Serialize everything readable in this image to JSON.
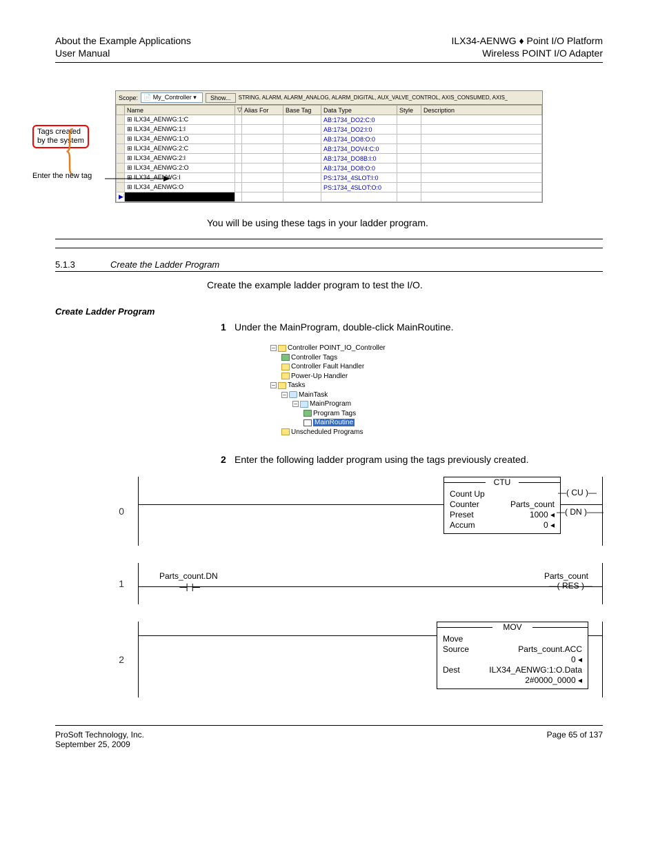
{
  "header": {
    "left1": "About the Example Applications",
    "left2": "User Manual",
    "right1": "ILX34-AENWG ♦ Point I/O Platform",
    "right2": "Wireless POINT I/O Adapter"
  },
  "fig1": {
    "callout_created1": "Tags created",
    "callout_created2": "by the system",
    "callout_enter": "Enter the new tag",
    "toolbar": {
      "scope_label": "Scope:",
      "scope_value": "My_Controller",
      "show_btn": "Show...",
      "filter": "STRING, ALARM, ALARM_ANALOG, ALARM_DIGITAL, AUX_VALVE_CONTROL, AXIS_CONSUMED, AXIS_"
    },
    "columns": {
      "name": "Name",
      "alias": "Alias For",
      "base": "Base Tag",
      "type": "Data Type",
      "style": "Style",
      "desc": "Description"
    },
    "rows": [
      {
        "name": "ILX34_AENWG:1:C",
        "type": "AB:1734_DO2:C:0"
      },
      {
        "name": "ILX34_AENWG:1:I",
        "type": "AB:1734_DO2:I:0"
      },
      {
        "name": "ILX34_AENWG:1:O",
        "type": "AB:1734_DO8:O:0"
      },
      {
        "name": "ILX34_AENWG:2:C",
        "type": "AB:1734_DOV4:C:0"
      },
      {
        "name": "ILX34_AENWG:2:I",
        "type": "AB:1734_DO8B:I:0"
      },
      {
        "name": "ILX34_AENWG:2:O",
        "type": "AB:1734_DO8:O:0"
      },
      {
        "name": "ILX34_AENWG:I",
        "type": "PS:1734_4SLOT:I:0"
      },
      {
        "name": "ILX34_AENWG:O",
        "type": "PS:1734_4SLOT:O:0"
      }
    ]
  },
  "body1": "You will be using these tags in your ladder program.",
  "section": {
    "num": "5.1.3",
    "title": "Create the Ladder Program"
  },
  "body2": "Create the example ladder program to test the I/O.",
  "heading_create": "Create Ladder Program",
  "steps": {
    "s1n": "1",
    "s1t": "Under the MainProgram, double-click MainRoutine.",
    "s2n": "2",
    "s2t": "Enter the following ladder program using the tags previously created."
  },
  "tree": {
    "controller": "Controller POINT_IO_Controller",
    "controller_tags": "Controller Tags",
    "fault_handler": "Controller Fault Handler",
    "powerup": "Power-Up Handler",
    "tasks": "Tasks",
    "maintask": "MainTask",
    "mainprogram": "MainProgram",
    "program_tags": "Program Tags",
    "mainroutine": "MainRoutine",
    "unscheduled": "Unscheduled Programs"
  },
  "ladder": {
    "r0": {
      "num": "0",
      "title": "CTU",
      "l1": "Count Up",
      "l2a": "Counter",
      "l2b": "Parts_count",
      "l3a": "Preset",
      "l3b": "1000",
      "l4a": "Accum",
      "l4b": "0",
      "out1": "CU",
      "out2": "DN"
    },
    "r1": {
      "num": "1",
      "xic": "Parts_count.DN",
      "out_label": "Parts_count",
      "out_sym": "RES"
    },
    "r2": {
      "num": "2",
      "title": "MOV",
      "l1": "Move",
      "l2a": "Source",
      "l2b": "Parts_count.ACC",
      "l2c": "0",
      "l3a": "Dest",
      "l3b": "ILX34_AENWG:1:O.Data",
      "l3c": "2#0000_0000"
    }
  },
  "footer": {
    "left": "ProSoft Technology, Inc.",
    "center": "",
    "right": "Page 65 of 137",
    "date": "September 25, 2009"
  }
}
